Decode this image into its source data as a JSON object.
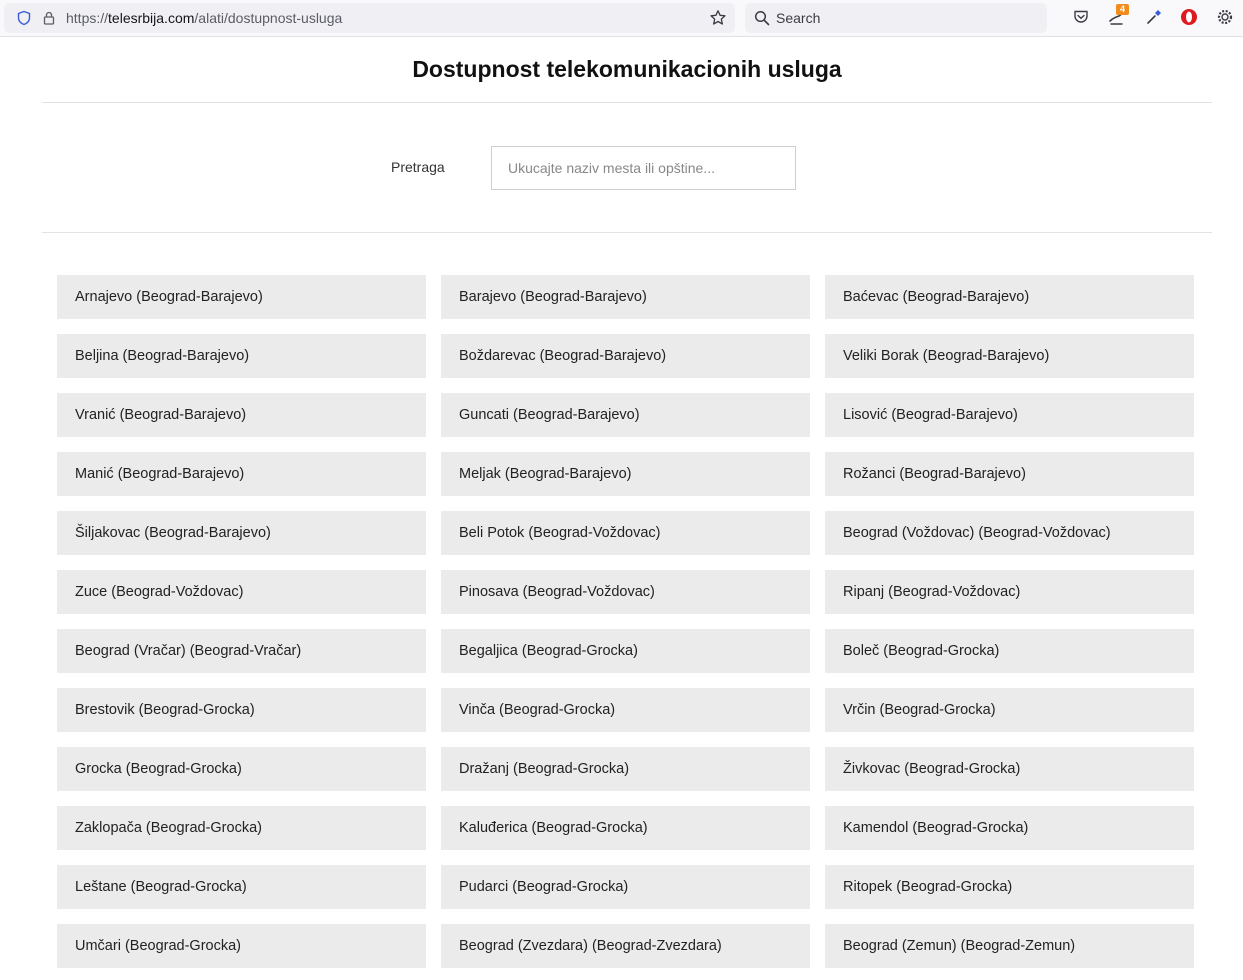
{
  "browser": {
    "url_prefix": "https://",
    "url_host": "telesrbija.com",
    "url_path": "/alati/dostupnost-usluga",
    "search_placeholder": "Search",
    "extension_badge": "4"
  },
  "page": {
    "title": "Dostupnost telekomunikacionih usluga",
    "search_label": "Pretraga",
    "search_placeholder": "Ukucajte naziv mesta ili opštine..."
  },
  "places": [
    "Arnajevo (Beograd-Barajevo)",
    "Barajevo (Beograd-Barajevo)",
    "Baćevac (Beograd-Barajevo)",
    "Beljina (Beograd-Barajevo)",
    "Boždarevac (Beograd-Barajevo)",
    "Veliki Borak (Beograd-Barajevo)",
    "Vranić (Beograd-Barajevo)",
    "Guncati (Beograd-Barajevo)",
    "Lisović (Beograd-Barajevo)",
    "Manić (Beograd-Barajevo)",
    "Meljak (Beograd-Barajevo)",
    "Rožanci (Beograd-Barajevo)",
    "Šiljakovac (Beograd-Barajevo)",
    "Beli Potok (Beograd-Voždovac)",
    "Beograd (Voždovac) (Beograd-Voždovac)",
    "Zuce (Beograd-Voždovac)",
    "Pinosava (Beograd-Voždovac)",
    "Ripanj (Beograd-Voždovac)",
    "Beograd (Vračar) (Beograd-Vračar)",
    "Begaljica (Beograd-Grocka)",
    "Boleč (Beograd-Grocka)",
    "Brestovik (Beograd-Grocka)",
    "Vinča (Beograd-Grocka)",
    "Vrčin (Beograd-Grocka)",
    "Grocka (Beograd-Grocka)",
    "Dražanj (Beograd-Grocka)",
    "Živkovac (Beograd-Grocka)",
    "Zaklopača (Beograd-Grocka)",
    "Kaluđerica (Beograd-Grocka)",
    "Kamendol (Beograd-Grocka)",
    "Leštane (Beograd-Grocka)",
    "Pudarci (Beograd-Grocka)",
    "Ritopek (Beograd-Grocka)",
    "Umčari (Beograd-Grocka)",
    "Beograd (Zvezdara) (Beograd-Zvezdara)",
    "Beograd (Zemun) (Beograd-Zemun)"
  ]
}
